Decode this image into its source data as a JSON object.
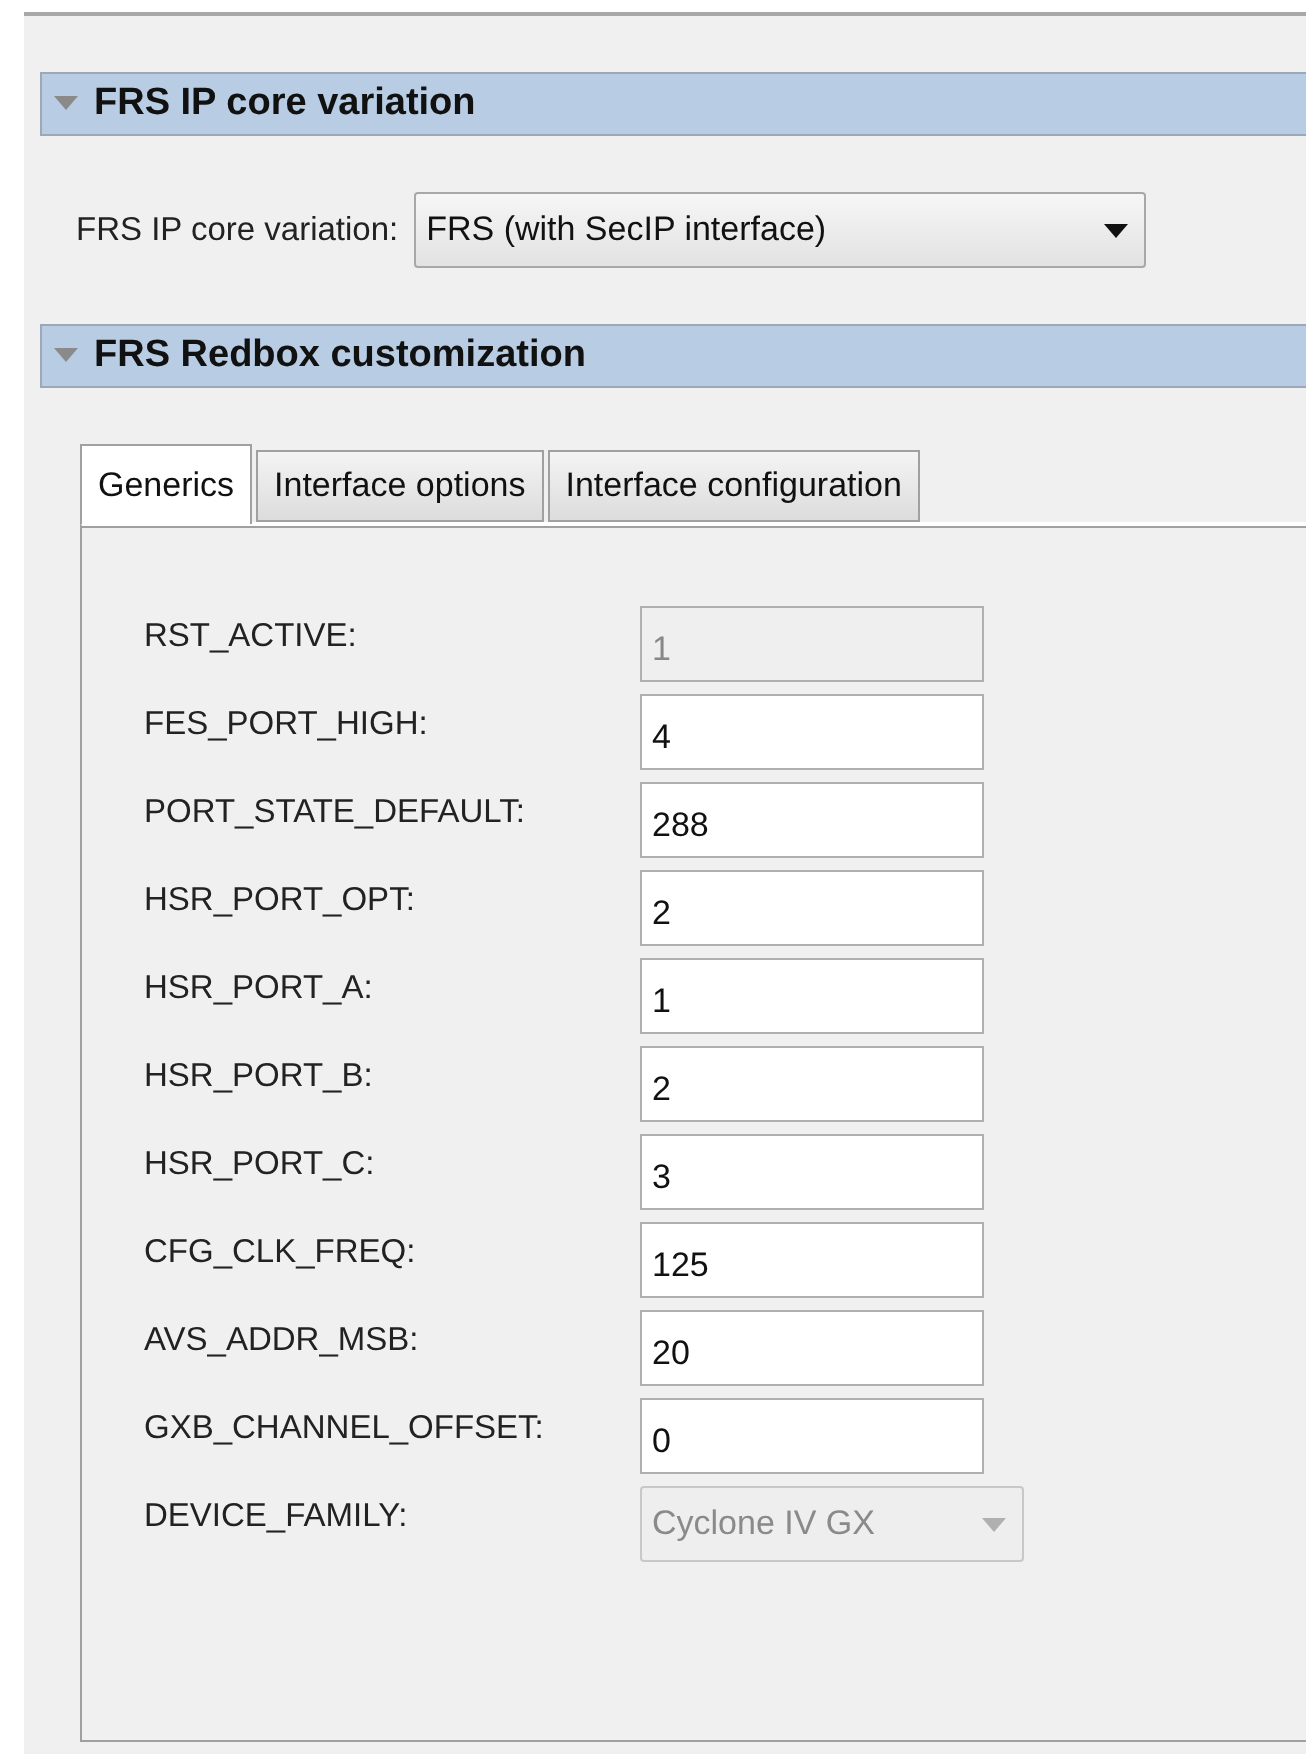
{
  "sections": [
    {
      "title": "FRS IP core variation",
      "expanded": true
    },
    {
      "title": "FRS Redbox customization",
      "expanded": true
    }
  ],
  "variation": {
    "label": "FRS IP core variation:",
    "value": "FRS (with SecIP interface)"
  },
  "tabs": [
    {
      "label": "Generics",
      "selected": true
    },
    {
      "label": "Interface options",
      "selected": false
    },
    {
      "label": "Interface configuration",
      "selected": false
    }
  ],
  "fields": [
    {
      "label": "RST_ACTIVE:",
      "kind": "text",
      "value": "1",
      "disabled": true
    },
    {
      "label": "FES_PORT_HIGH:",
      "kind": "text",
      "value": "4",
      "disabled": false
    },
    {
      "label": "PORT_STATE_DEFAULT:",
      "kind": "text",
      "value": "288",
      "disabled": false
    },
    {
      "label": "HSR_PORT_OPT:",
      "kind": "text",
      "value": "2",
      "disabled": false
    },
    {
      "label": "HSR_PORT_A:",
      "kind": "text",
      "value": "1",
      "disabled": false
    },
    {
      "label": "HSR_PORT_B:",
      "kind": "text",
      "value": "2",
      "disabled": false
    },
    {
      "label": "HSR_PORT_C:",
      "kind": "text",
      "value": "3",
      "disabled": false
    },
    {
      "label": "CFG_CLK_FREQ:",
      "kind": "text",
      "value": "125",
      "disabled": false
    },
    {
      "label": "AVS_ADDR_MSB:",
      "kind": "text",
      "value": "20",
      "disabled": false
    },
    {
      "label": "GXB_CHANNEL_OFFSET:",
      "kind": "text",
      "value": "0",
      "disabled": false
    },
    {
      "label": "DEVICE_FAMILY:",
      "kind": "select",
      "value": "Cyclone IV GX",
      "disabled": true
    }
  ]
}
